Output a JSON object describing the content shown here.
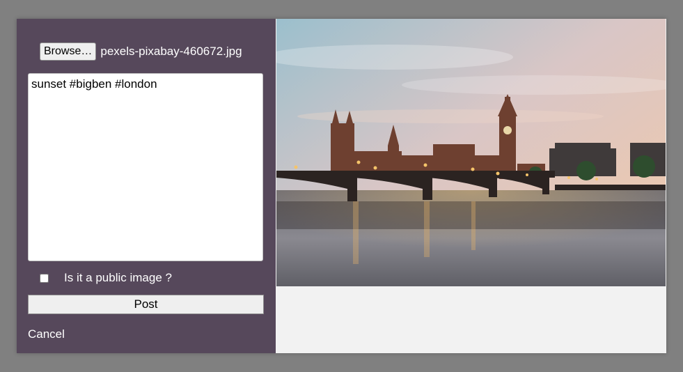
{
  "upload": {
    "browse_label": "Browse…",
    "file_name": "pexels-pixabay-460672.jpg"
  },
  "caption": {
    "value": "sunset #bigben #london"
  },
  "public_option": {
    "label": "Is it a public image ?",
    "checked": false
  },
  "actions": {
    "post_label": "Post",
    "cancel_label": "Cancel"
  },
  "colors": {
    "panel_background": "#56485b",
    "page_overlay": "#808080",
    "preview_background": "#f2f2f2"
  },
  "preview": {
    "icon": "image-preview",
    "subject": "Big Ben and Westminster Bridge at sunset"
  }
}
